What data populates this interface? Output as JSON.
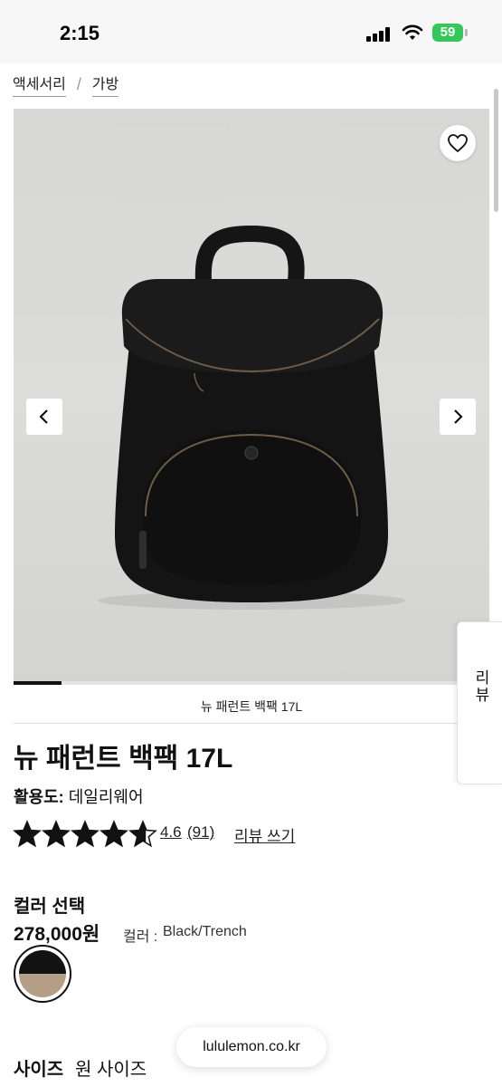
{
  "status_bar": {
    "time": "2:15",
    "battery": "59"
  },
  "breadcrumb": {
    "items": [
      "액세서리",
      "가방"
    ],
    "separator": "/"
  },
  "gallery": {
    "caption": "뉴 패런트 백팩 17L",
    "progress": 0.1
  },
  "review_tab": {
    "label": "리뷰"
  },
  "product": {
    "title": "뉴 패런트 백팩 17L",
    "activity_label": "활용도:",
    "activity_value": "데일리웨어",
    "rating_value": "4.6",
    "rating_count": "(91)",
    "write_review": "리뷰 쓰기",
    "rating_stars": 4.6
  },
  "color": {
    "section_title": "컬러 선택",
    "price": "278,000원",
    "name_label": "컬러 :",
    "name": "Black/Trench",
    "swatch_colors": {
      "top": "#121212",
      "bottom": "#b49e86"
    }
  },
  "browser": {
    "url": "lululemon.co.kr"
  },
  "size": {
    "section_title": "사이즈",
    "value": "원 사이즈"
  }
}
